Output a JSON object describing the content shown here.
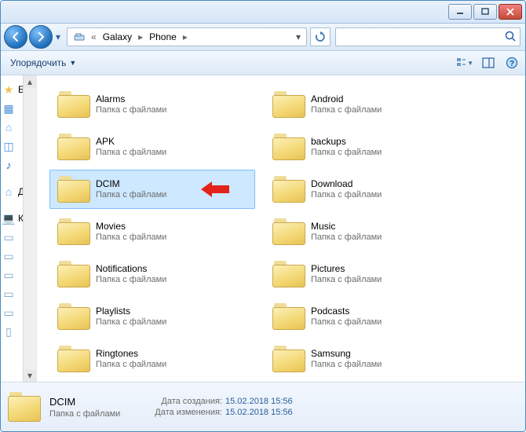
{
  "breadcrumbs": {
    "seg1": "Galaxy",
    "seg2": "Phone"
  },
  "toolbar": {
    "organize": "Упорядочить"
  },
  "sidebar": {
    "items": [
      {
        "label": "Би",
        "glyph": "★",
        "color": "#f2c14e"
      },
      {
        "label": "",
        "glyph": "▦",
        "color": "#4a8fd6"
      },
      {
        "label": "",
        "glyph": "⌂",
        "color": "#6aa9e6"
      },
      {
        "label": "",
        "glyph": "◫",
        "color": "#4a8fd6"
      },
      {
        "label": "",
        "glyph": "♪",
        "color": "#2f6fbf"
      },
      {
        "label": "Дс",
        "glyph": "⌂",
        "color": "#6aa9e6"
      },
      {
        "label": "Кс",
        "glyph": "💻",
        "color": ""
      },
      {
        "label": "",
        "glyph": "▭",
        "color": "#7aa4cc"
      },
      {
        "label": "",
        "glyph": "▭",
        "color": "#7aa4cc"
      },
      {
        "label": "",
        "glyph": "▭",
        "color": "#7aa4cc"
      },
      {
        "label": "",
        "glyph": "▭",
        "color": "#7aa4cc"
      },
      {
        "label": "",
        "glyph": "▭",
        "color": "#7aa4cc"
      },
      {
        "label": "",
        "glyph": "▯",
        "color": "#7aa4cc"
      }
    ]
  },
  "subline": "Папка с файлами",
  "folders": [
    {
      "name": "Alarms",
      "selected": false
    },
    {
      "name": "Android",
      "selected": false
    },
    {
      "name": "APK",
      "selected": false
    },
    {
      "name": "backups",
      "selected": false
    },
    {
      "name": "DCIM",
      "selected": true,
      "callout": true
    },
    {
      "name": "Download",
      "selected": false
    },
    {
      "name": "Movies",
      "selected": false
    },
    {
      "name": "Music",
      "selected": false
    },
    {
      "name": "Notifications",
      "selected": false
    },
    {
      "name": "Pictures",
      "selected": false
    },
    {
      "name": "Playlists",
      "selected": false
    },
    {
      "name": "Podcasts",
      "selected": false
    },
    {
      "name": "Ringtones",
      "selected": false
    },
    {
      "name": "Samsung",
      "selected": false
    }
  ],
  "details": {
    "name": "DCIM",
    "type": "Папка с файлами",
    "created_label": "Дата создания:",
    "created_value": "15.02.2018 15:56",
    "modified_label": "Дата изменения:",
    "modified_value": "15.02.2018 15:56"
  }
}
